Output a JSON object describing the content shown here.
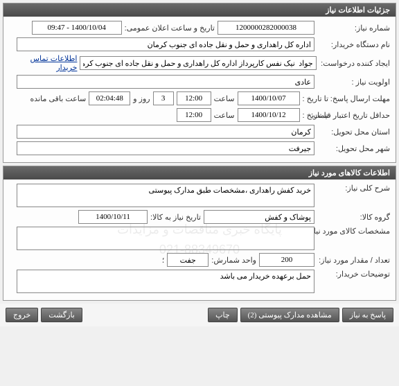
{
  "panel1": {
    "title": "جزئیات اطلاعات نیاز",
    "need_number_label": "شماره نیاز:",
    "need_number": "1200000282000038",
    "announce_label": "تاریخ و ساعت اعلان عمومی:",
    "announce_value": "1400/10/04 - 09:47",
    "buyer_org_label": "نام دستگاه خریدار:",
    "buyer_org": "اداره کل راهداری و حمل و نقل جاده ای جنوب کرمان",
    "requester_label": "ایجاد کننده درخواست:",
    "requester": "جواد  نیک نفس کارپرداز اداره کل راهداری و حمل و نقل جاده ای جنوب کرمان",
    "contact_link": "اطلاعات تماس خریدار",
    "priority_label": "اولویت نیاز :",
    "priority": "عادی",
    "deadline_label": "مهلت ارسال پاسخ:",
    "to_date_label": "تا تاریخ :",
    "deadline_date": "1400/10/07",
    "time_label": "ساعت",
    "deadline_time": "12:00",
    "days_val": "3",
    "days_and": "روز و",
    "countdown": "02:04:48",
    "remaining": "ساعت باقی مانده",
    "min_validity_label": "حداقل تاریخ اعتبار قیمت:",
    "min_validity_date": "1400/10/12",
    "min_validity_time": "12:00",
    "province_label": "استان محل تحویل:",
    "province": "کرمان",
    "city_label": "شهر محل تحویل:",
    "city": "جیرفت"
  },
  "panel2": {
    "title": "اطلاعات کالاهای مورد نیاز",
    "desc_label": "شرح کلی نیاز:",
    "desc": "خرید کفش راهداری ،مشخصات طبق مدارک پیوستی",
    "group_label": "گروه کالا:",
    "group": "پوشاک و کفش",
    "need_date_label": "تاریخ نیاز به کالا:",
    "need_date": "1400/10/11",
    "spec_label": "مشخصات کالای مورد نیاز:",
    "spec": "",
    "qty_label": "تعداد / مقدار مورد نیاز:",
    "qty": "200",
    "unit_label": "واحد شمارش:",
    "unit": "جفت",
    "buyer_notes_label": "توضیحات خریدار:",
    "buyer_notes": "حمل برعهده خریدار می باشد"
  },
  "watermark": {
    "line1": "پایگاه خبری مناقصات و مزایدات",
    "line2": "021-88349670"
  },
  "buttons": {
    "reply": "پاسخ به نیاز",
    "attachments": "مشاهده مدارک پیوستی (2)",
    "print": "چاپ",
    "back": "بازگشت",
    "exit": "خروج"
  }
}
